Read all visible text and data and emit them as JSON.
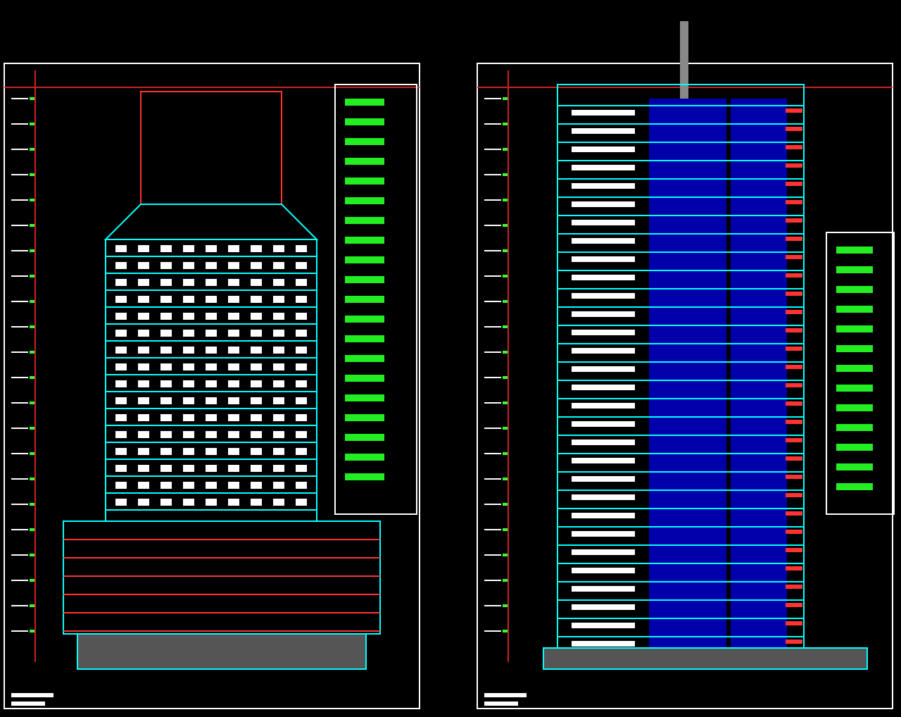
{
  "sheets": [
    {
      "kind": "podium-tower"
    },
    {
      "kind": "slender-tower"
    }
  ]
}
